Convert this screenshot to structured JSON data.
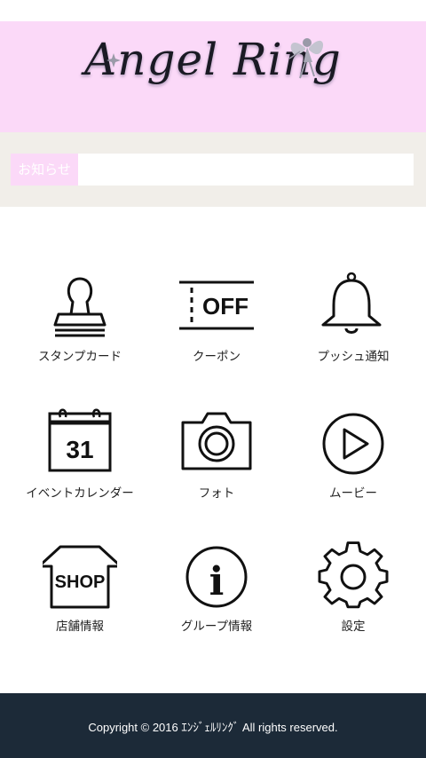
{
  "header": {
    "logo_text": "Angel Ring"
  },
  "news": {
    "tag_label": "お知らせ",
    "content": ""
  },
  "menu": [
    {
      "label": "スタンプカード",
      "icon": "stamp-icon"
    },
    {
      "label": "クーポン",
      "icon": "coupon-icon",
      "icon_text": "OFF"
    },
    {
      "label": "プッシュ通知",
      "icon": "bell-icon"
    },
    {
      "label": "イベントカレンダー",
      "icon": "calendar-icon",
      "icon_text": "31"
    },
    {
      "label": "フォト",
      "icon": "camera-icon"
    },
    {
      "label": "ムービー",
      "icon": "play-icon"
    },
    {
      "label": "店舗情報",
      "icon": "shop-icon",
      "icon_text": "SHOP"
    },
    {
      "label": "グループ情報",
      "icon": "info-icon",
      "icon_text": "i"
    },
    {
      "label": "設定",
      "icon": "gear-icon"
    }
  ],
  "footer": {
    "copyright": "Copyright © 2016 ｴﾝｼﾞｪﾙﾘﾝｸﾞ  All rights reserved."
  },
  "colors": {
    "banner_bg": "#fbd9f8",
    "news_bg": "#f1eee9",
    "footer_bg": "#1c2a38",
    "icon_stroke": "#111111"
  }
}
